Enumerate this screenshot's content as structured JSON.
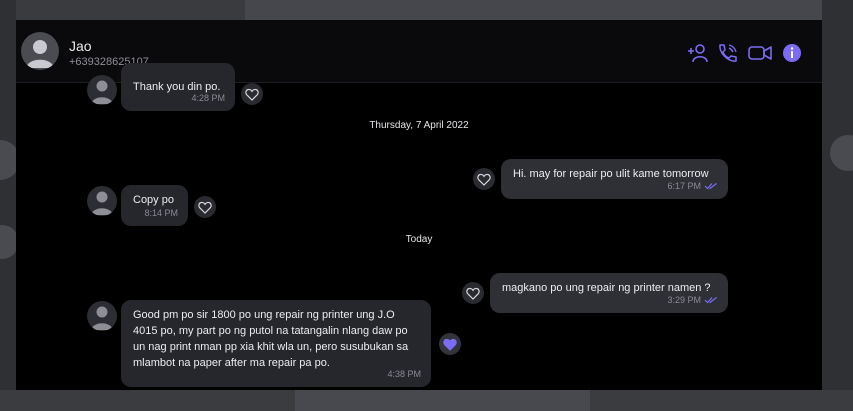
{
  "contact": {
    "name": "Jao",
    "phone": "+639328625107"
  },
  "header_icons": [
    "add-participant-icon",
    "voice-call-icon",
    "video-call-icon",
    "info-icon"
  ],
  "colors": {
    "accent": "#7b6cf6",
    "background": "#000000",
    "bubble": "#26272c"
  },
  "messages": [
    {
      "direction": "incoming",
      "text": "Thank you din po.",
      "time": "4:28 PM"
    },
    {
      "direction": "outgoing",
      "text": "Hi. may for repair po ulit kame tomorrow",
      "time": "6:17 PM"
    },
    {
      "direction": "incoming",
      "text": "Copy po",
      "time": "8:14 PM"
    },
    {
      "direction": "outgoing",
      "text": "magkano po ung repair ng printer namen ?",
      "time": "3:29 PM"
    },
    {
      "direction": "incoming",
      "text": "Good pm po sir 1800 po ung repair ng printer ung J.O\n4015 po, my part po ng putol na tatangalin nlang daw po\nun nag print nman pp xia khit wla un, pero susubukan sa\nmlambot na paper after ma repair pa po.",
      "time": "4:38 PM"
    }
  ],
  "dividers": [
    "Thursday, 7 April 2022",
    "Today"
  ]
}
